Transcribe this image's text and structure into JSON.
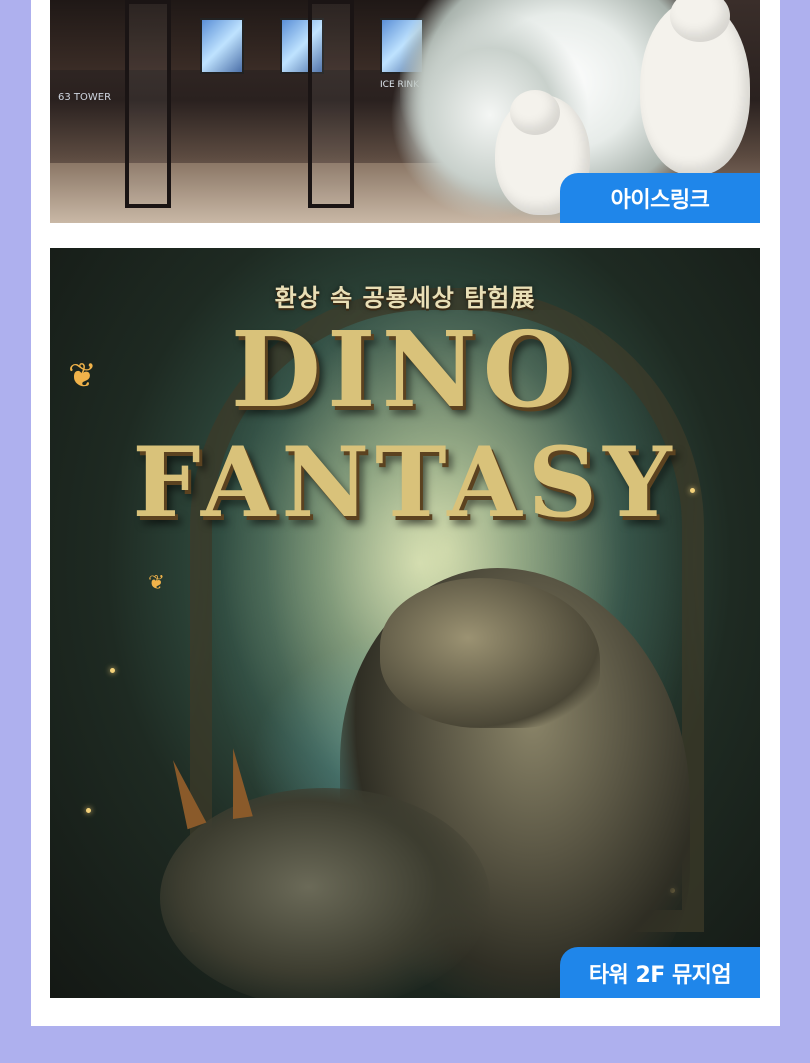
{
  "cards": {
    "ice_rink": {
      "label": "아이스링크",
      "sign_text": "ICE RINK",
      "tower_text": "63 TOWER"
    },
    "dino": {
      "headline": "환상 속 공룡세상 탐험展",
      "title_line1": "DINO",
      "title_line2": "FANTASY",
      "label": "타워 2F 뮤지엄"
    }
  },
  "colors": {
    "page_background": "#aeb0ee",
    "panel": "#ffffff",
    "badge": "#1f86ea",
    "title_gold": "#d9c27a"
  }
}
